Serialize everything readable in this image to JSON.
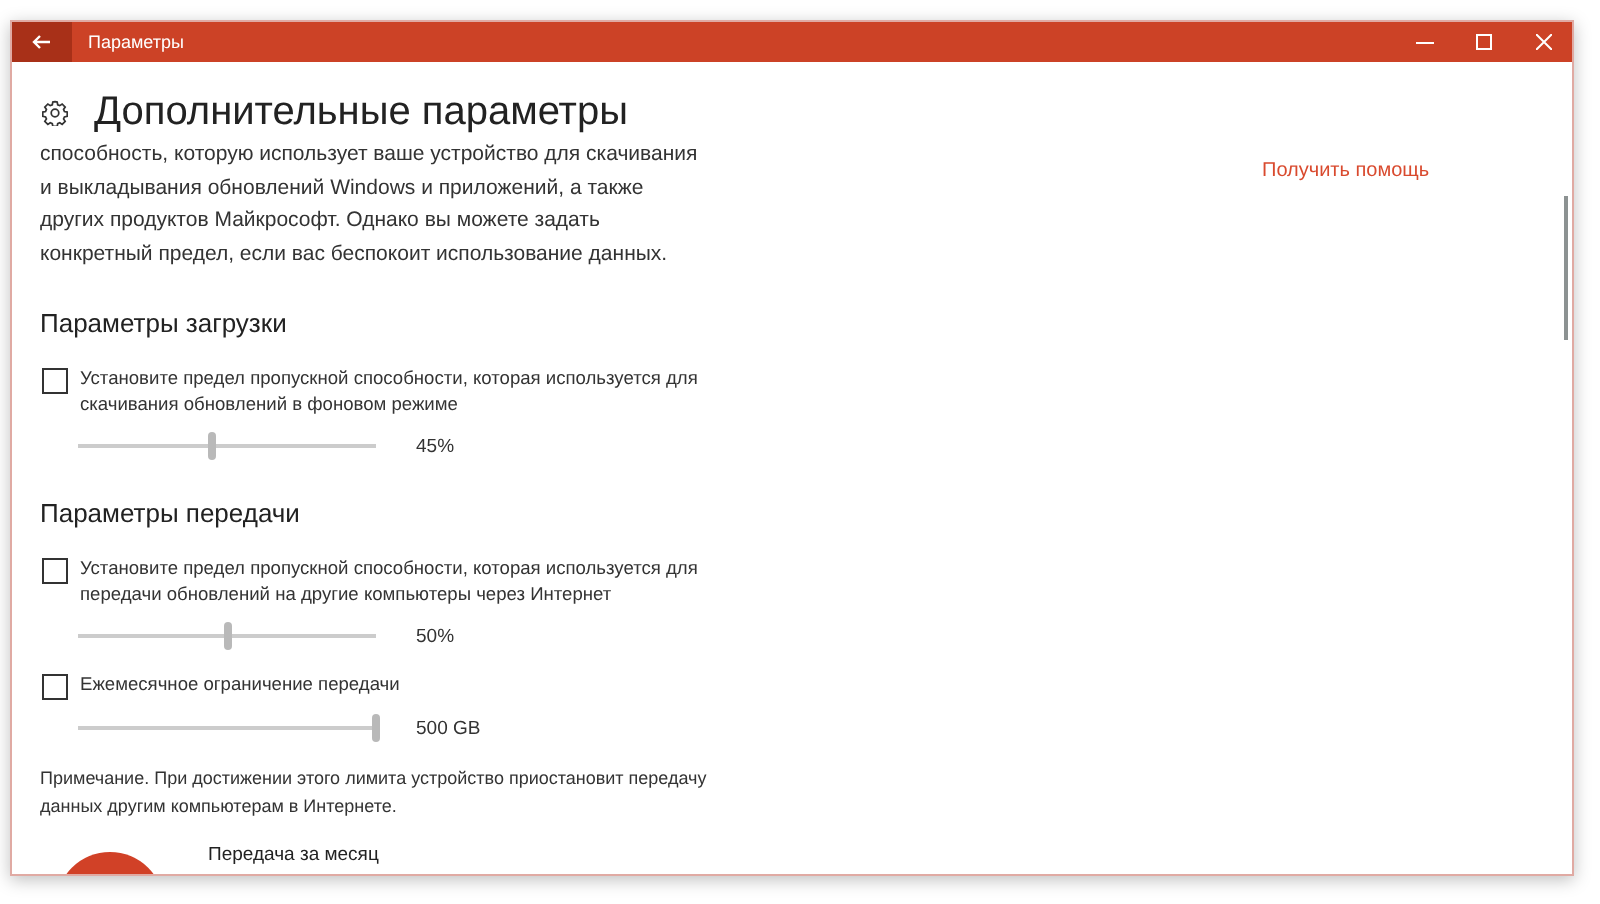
{
  "window": {
    "title": "Параметры"
  },
  "page_title": "Дополнительные параметры",
  "intro": "способность, которую использует ваше устройство для скачивания и выкладывания обновлений Windows и приложений, а также других продуктов Майкрософт. Однако вы можете задать конкретный предел, если вас беспокоит использование данных.",
  "help_link": "Получить помощь",
  "sections": [
    {
      "heading": "Параметры загрузки",
      "items": [
        {
          "kind": "checkbox",
          "label": "Установите предел пропускной способности, которая используется для скачивания обновлений в фоновом режиме",
          "checked": false
        },
        {
          "kind": "slider",
          "level": 0.45,
          "reading": "45%"
        }
      ]
    },
    {
      "heading": "Параметры передачи",
      "items": [
        {
          "kind": "checkbox",
          "label": "Установите предел пропускной способности, которая используется для передачи обновлений на другие компьютеры через Интернет",
          "checked": false
        },
        {
          "kind": "slider",
          "level": 0.5,
          "reading": "50%"
        },
        {
          "kind": "checkbox",
          "label": "Ежемесячное ограничение передачи",
          "checked": false
        },
        {
          "kind": "slider",
          "level": 1,
          "reading": "500 GB"
        },
        {
          "kind": "note",
          "label": "Примечание. При достижении этого лимита устройство приостановит передачу данных другим компьютерам в Интернете."
        }
      ]
    }
  ],
  "monthly": {
    "label": "Передача за месяц"
  }
}
